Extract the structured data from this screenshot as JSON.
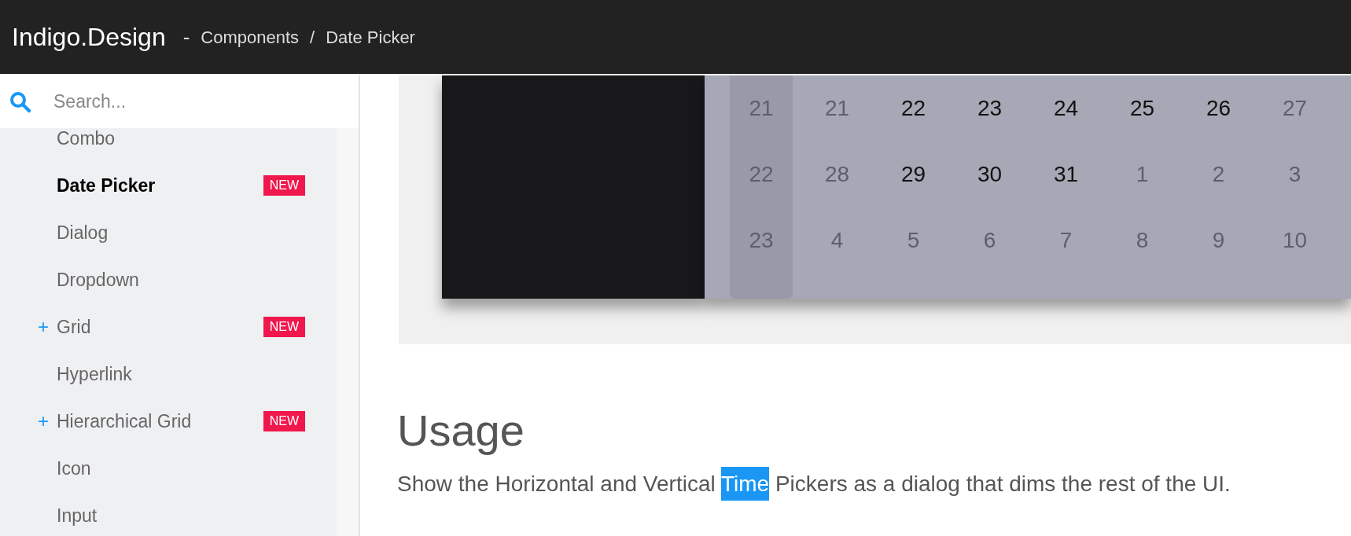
{
  "header": {
    "brand": "Indigo.Design",
    "separator": "-",
    "crumbs": [
      {
        "label": "Components"
      },
      {
        "label": "Date Picker",
        "divider": "/"
      }
    ]
  },
  "search": {
    "placeholder": "Search..."
  },
  "sidebar": {
    "items": [
      {
        "label": "Combo",
        "selected": false
      },
      {
        "label": "Date Picker",
        "selected": true,
        "badge": "NEW"
      },
      {
        "label": "Dialog",
        "selected": false
      },
      {
        "label": "Dropdown",
        "selected": false
      },
      {
        "label": "Grid",
        "selected": false,
        "toggle": "+",
        "badge": "NEW"
      },
      {
        "label": "Hyperlink",
        "selected": false
      },
      {
        "label": "Hierarchical Grid",
        "selected": false,
        "toggle": "+",
        "badge": "NEW"
      },
      {
        "label": "Icon",
        "selected": false
      },
      {
        "label": "Input",
        "selected": false
      }
    ]
  },
  "calendar": {
    "weeks": [
      {
        "number": "21",
        "days": [
          {
            "text": "21",
            "outside": true
          },
          {
            "text": "22",
            "outside": false
          },
          {
            "text": "23",
            "outside": false
          },
          {
            "text": "24",
            "outside": false
          },
          {
            "text": "25",
            "outside": false
          },
          {
            "text": "26",
            "outside": false
          },
          {
            "text": "27",
            "outside": true
          }
        ]
      },
      {
        "number": "22",
        "days": [
          {
            "text": "28",
            "outside": true
          },
          {
            "text": "29",
            "outside": false
          },
          {
            "text": "30",
            "outside": false
          },
          {
            "text": "31",
            "outside": false
          },
          {
            "text": "1",
            "outside": true
          },
          {
            "text": "2",
            "outside": true
          },
          {
            "text": "3",
            "outside": true
          }
        ]
      },
      {
        "number": "23",
        "days": [
          {
            "text": "4",
            "outside": true
          },
          {
            "text": "5",
            "outside": true
          },
          {
            "text": "6",
            "outside": true
          },
          {
            "text": "7",
            "outside": true
          },
          {
            "text": "8",
            "outside": true
          },
          {
            "text": "9",
            "outside": true
          },
          {
            "text": "10",
            "outside": true
          }
        ]
      }
    ]
  },
  "usage": {
    "heading": "Usage",
    "paragraph": [
      {
        "text": "Show the Horizontal and Vertical ",
        "selected": false
      },
      {
        "text": "Time",
        "selected": true
      },
      {
        "text": " Pickers as a dialog that dims the rest of the UI.",
        "selected": false
      }
    ]
  }
}
